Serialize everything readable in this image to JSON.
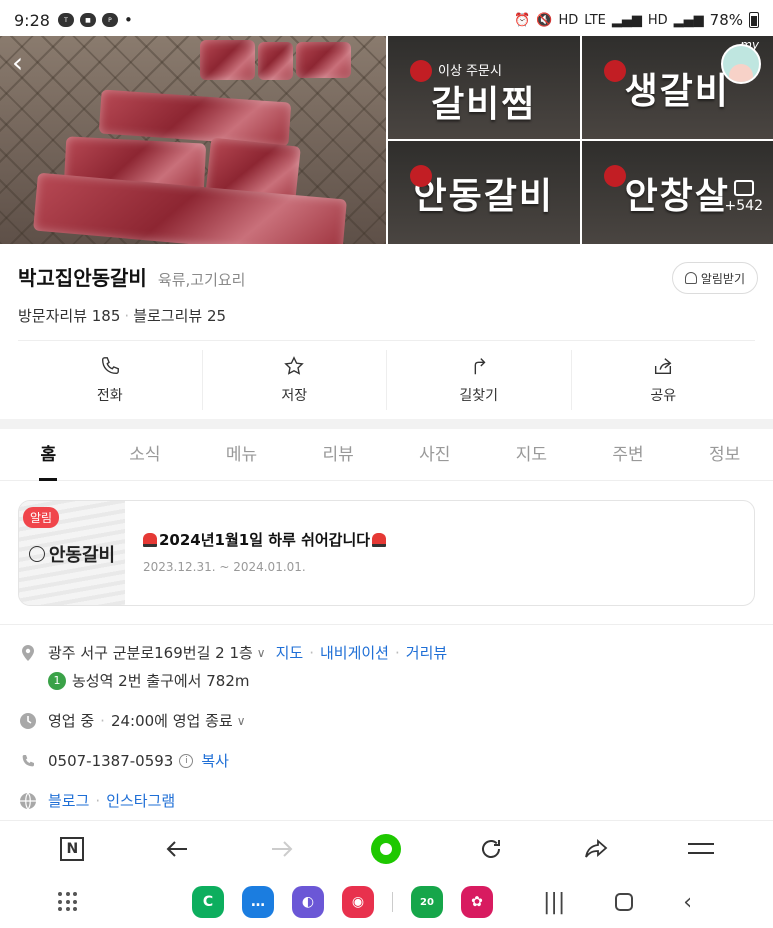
{
  "status_bar": {
    "time": "9:28",
    "battery": "78%",
    "net_labels": [
      "HD",
      "LTE",
      "HD"
    ]
  },
  "hero": {
    "tiles": [
      {
        "text": "갈비찜",
        "sub": "이상 주문시"
      },
      {
        "text": "생갈비",
        "sub": ""
      },
      {
        "text": "안동갈비",
        "sub": ""
      },
      {
        "text": "안창살",
        "sub": ""
      }
    ],
    "more_count": "+542",
    "my_label": "my"
  },
  "place": {
    "name": "박고집안동갈비",
    "category": "육류,고기요리",
    "visitor_reviews": "방문자리뷰 185",
    "blog_reviews": "블로그리뷰 25",
    "alarm_label": "알림받기"
  },
  "actions": [
    {
      "label": "전화",
      "icon": "phone-icon"
    },
    {
      "label": "저장",
      "icon": "star-icon"
    },
    {
      "label": "길찾기",
      "icon": "directions-icon"
    },
    {
      "label": "공유",
      "icon": "share-icon"
    }
  ],
  "tabs": [
    "홈",
    "소식",
    "메뉴",
    "리뷰",
    "사진",
    "지도",
    "주변",
    "정보"
  ],
  "active_tab": "홈",
  "notice": {
    "badge": "알림",
    "logo_text": "안동갈비",
    "title": "2024년1월1일 하루 쉬어갑니다",
    "date": "2023.12.31. ~ 2024.01.01."
  },
  "info": {
    "address": "광주 서구 군분로169번길 2 1층",
    "map_link": "지도",
    "nav_link": "내비게이션",
    "street_link": "거리뷰",
    "subway_line": "1",
    "subway_text": "농성역 2번 출구에서 782m",
    "hours_status": "영업 중",
    "hours_text": "24:00에 영업 종료",
    "phone": "0507-1387-0593",
    "copy_label": "복사",
    "blog_link": "블로그",
    "insta_link": "인스타그램"
  },
  "browser_bar": {
    "n_label": "N"
  },
  "colors": {
    "link": "#1f6fd6",
    "badge_red": "#f0454b",
    "naver_green": "#1ec800",
    "subway_green": "#3aa248"
  }
}
